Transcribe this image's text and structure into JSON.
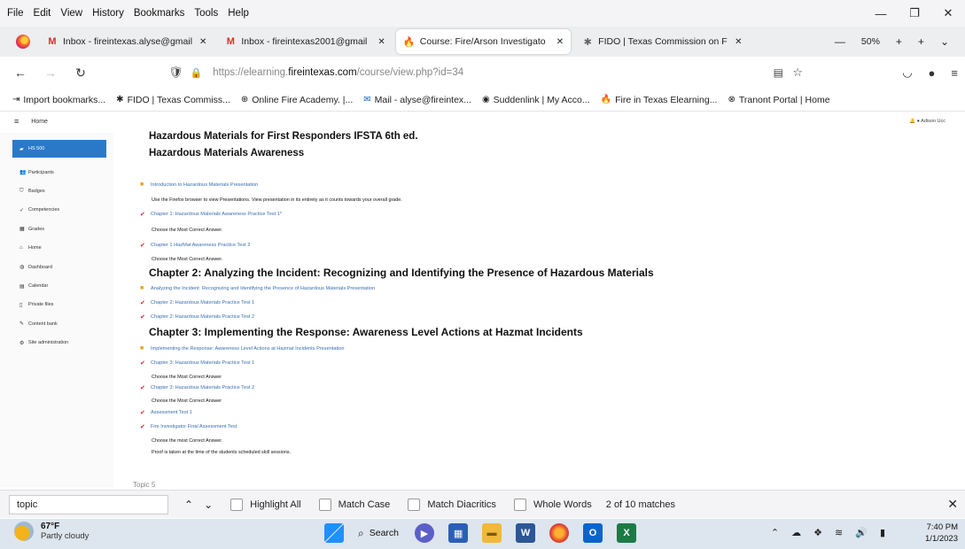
{
  "menu": {
    "items": [
      "File",
      "Edit",
      "View",
      "History",
      "Bookmarks",
      "Tools",
      "Help"
    ]
  },
  "window": {
    "minimize": "—",
    "restore": "❐",
    "close": "✕"
  },
  "tabs": [
    {
      "title": "Inbox - fireintexas.alyse@gmail",
      "icon": "M"
    },
    {
      "title": "Inbox - fireintexas2001@gmail",
      "icon": "M"
    },
    {
      "title": "Course: Fire/Arson Investigato",
      "icon": "🔥",
      "active": true
    },
    {
      "title": "FIDO | Texas Commission on F",
      "icon": "✱"
    }
  ],
  "tab_close": "✕",
  "browser": {
    "zoom": "50%",
    "zoom_minus": "—",
    "zoom_plus": "+",
    "new_tab": "+",
    "tab_list": "⌄"
  },
  "nav": {
    "back": "←",
    "forward": "→",
    "reload": "↻",
    "url_prefix": "https://elearning.",
    "url_host": "fireintexas.com",
    "url_path": "/course/view.php?id=34"
  },
  "bookmarks": [
    {
      "icon": "⇥",
      "label": "Import bookmarks..."
    },
    {
      "icon": "✱",
      "label": "FIDO | Texas Commiss..."
    },
    {
      "icon": "⊕",
      "label": "Online Fire Academy. |..."
    },
    {
      "icon": "✉",
      "label": "Mail - alyse@fireintex..."
    },
    {
      "icon": "◉",
      "label": "Suddenlink | My Acco..."
    },
    {
      "icon": "🔥",
      "label": "Fire in Texas Elearning..."
    },
    {
      "icon": "⊗",
      "label": "Tranont Portal | Home"
    }
  ],
  "site": {
    "home": "Home",
    "user": "Adison Ucc"
  },
  "sidebar": {
    "items": [
      {
        "icon": "▰",
        "label": "HS 500",
        "active": true
      },
      {
        "icon": "👥",
        "label": "Participants"
      },
      {
        "icon": "⛉",
        "label": "Badges"
      },
      {
        "icon": "✓",
        "label": "Competencies"
      },
      {
        "icon": "▦",
        "label": "Grades"
      },
      {
        "icon": "⌂",
        "label": "Home"
      },
      {
        "icon": "◍",
        "label": "Dashboard"
      },
      {
        "icon": "▤",
        "label": "Calendar"
      },
      {
        "icon": "▯",
        "label": "Private files"
      },
      {
        "icon": "✎",
        "label": "Content bank"
      },
      {
        "icon": "⚙",
        "label": "Site administration"
      }
    ]
  },
  "course": {
    "title_line1": "Hazardous Materials for First Responders IFSTA 6th ed.",
    "title_line2": "Hazardous Materials Awareness",
    "items": [
      {
        "kind": "pres",
        "text": "Introduction to Hazardous Materials Presentation"
      },
      {
        "kind": "note",
        "text": "Use the Firefox browser to view Presentations.  View presentation in its entirety as it counts towards your overall grade."
      },
      {
        "kind": "quiz",
        "text": "Chapter 1: Hazardous Materials Awareness Practice Test 1*"
      },
      {
        "kind": "note",
        "text": "Choose the Most Correct Answer."
      },
      {
        "kind": "quiz",
        "text": "Chapter 1 HazMat Awareness Practice Test 2"
      },
      {
        "kind": "note",
        "text": "Choose the Most Correct Answer."
      },
      {
        "kind": "heading",
        "text": "Chapter 2:  Analyzing the Incident:  Recognizing and Identifying the Presence of Hazardous Materials"
      },
      {
        "kind": "pres",
        "text": "Analyzing the Incident: Recognizing and Identifying the Presence of Hazardous Materials Presentation"
      },
      {
        "kind": "quiz",
        "text": "Chapter 2: Hazardous Materials Practice Test 1"
      },
      {
        "kind": "quiz",
        "text": "Chapter 2: Hazardous Materials Practice Test 2"
      },
      {
        "kind": "heading",
        "text": "Chapter 3:  Implementing the Response:  Awareness Level Actions at Hazmat Incidents"
      },
      {
        "kind": "pres",
        "text": "Implementing the Response: Awareness Level Actions at Hazmat Incidents Presentation"
      },
      {
        "kind": "quiz",
        "text": "Chapter 3: Hazardous Materials Practice Test 1"
      },
      {
        "kind": "note",
        "text": "Choose the Most Correct Answer"
      },
      {
        "kind": "quiz",
        "text": "Chapter 3: Hazardous Materials Practice Test 2"
      },
      {
        "kind": "note",
        "text": "Choose the Most Correct Answer"
      },
      {
        "kind": "quiz",
        "text": "Assessment Test 1"
      },
      {
        "kind": "quiz",
        "text": "Fire Investigator Final Assessment Test"
      },
      {
        "kind": "note",
        "text": "Choose the most Correct Answer."
      },
      {
        "kind": "note",
        "text": "Proof is taken at the time of the students scheduled skill sessions."
      }
    ],
    "next_topic": "Topic 5"
  },
  "find": {
    "value": "topic",
    "prev": "⌃",
    "next": "⌄",
    "highlight_all": "Highlight All",
    "match_case": "Match Case",
    "match_diacritics": "Match Diacritics",
    "whole_words": "Whole Words",
    "matches": "2 of 10 matches",
    "close": "✕"
  },
  "taskbar": {
    "temp": "67°F",
    "condition": "Partly cloudy",
    "search": "Search",
    "time": "7:40 PM",
    "date": "1/1/2023"
  },
  "colors": {
    "sidebar_active": "#2a79c9",
    "link": "#3a6fb3",
    "quiz_icon": "#cc2a2a",
    "presentation_icon": "#e1a51e"
  }
}
